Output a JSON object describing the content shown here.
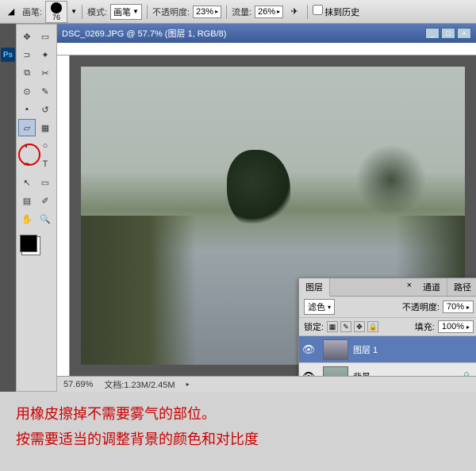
{
  "options": {
    "brush_label": "画笔:",
    "brush_size": "76",
    "mode_label": "模式:",
    "mode_value": "画笔",
    "opacity_label": "不透明度:",
    "opacity_value": "23%",
    "flow_label": "流量:",
    "flow_value": "26%",
    "erase_history_label": "抹到历史"
  },
  "document": {
    "title": "DSC_0269.JPG @ 57.7% (图层 1, RGB/8)",
    "zoom": "57.69%",
    "doc_label": "文档:",
    "doc_size": "1.23M/2.45M"
  },
  "layers": {
    "tabs": {
      "layers": "图层",
      "channels": "通道",
      "paths": "路径"
    },
    "blend_mode": "滤色",
    "opacity_label": "不透明度:",
    "opacity_value": "70%",
    "lock_label": "锁定:",
    "fill_label": "填充:",
    "fill_value": "100%",
    "items": [
      {
        "name": "图层 1",
        "active": true
      },
      {
        "name": "背景",
        "active": false
      }
    ]
  },
  "annotations": {
    "line1": "用橡皮擦掉不需要雾气的部位。",
    "line2": "按需要适当的调整背景的颜色和对比度"
  }
}
